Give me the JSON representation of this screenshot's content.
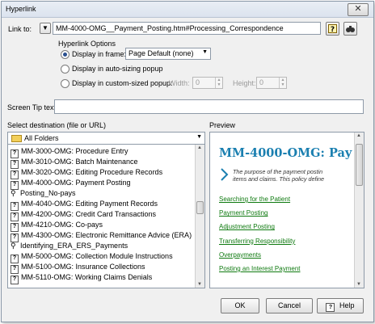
{
  "window": {
    "title": "Hyperlink",
    "close_glyph": "✕"
  },
  "link": {
    "label": "Link to:",
    "value": "MM-4000-OMG__Payment_Posting.htm#Processing_Correspondence"
  },
  "options": {
    "group_label": "Hyperlink Options",
    "frame_label": "Display in frame:",
    "frame_value": "Page Default (none)",
    "autosize_label": "Display in auto-sizing popup",
    "custom_label": "Display in custom-sized popup:",
    "width_label": "Width:",
    "width_value": "0",
    "height_label": "Height:",
    "height_value": "0"
  },
  "screentip": {
    "label": "Screen Tip text:",
    "value": ""
  },
  "destination": {
    "label": "Select destination (file or URL)",
    "folder": "All Folders",
    "items": [
      {
        "icon": "topic",
        "label": "MM-3000-OMG: Procedure Entry"
      },
      {
        "icon": "topic",
        "label": "MM-3010-OMG: Batch Maintenance"
      },
      {
        "icon": "topic",
        "label": "MM-3020-OMG: Editing Procedure Records"
      },
      {
        "icon": "topic",
        "label": "MM-4000-OMG: Payment Posting"
      },
      {
        "icon": "bookmark",
        "label": "Posting_No-pays"
      },
      {
        "icon": "topic",
        "label": "MM-4040-OMG: Editing Payment Records"
      },
      {
        "icon": "topic",
        "label": "MM-4200-OMG: Credit Card Transactions"
      },
      {
        "icon": "topic",
        "label": "MM-4210-OMG: Co-pays"
      },
      {
        "icon": "topic",
        "label": "MM-4300-OMG: Electronic Remittance Advice (ERA)"
      },
      {
        "icon": "bookmark",
        "label": "Identifying_ERA_ERS_Payments"
      },
      {
        "icon": "topic",
        "label": "MM-5000-OMG: Collection Module Instructions"
      },
      {
        "icon": "topic",
        "label": "MM-5100-OMG: Insurance Collections"
      },
      {
        "icon": "topic",
        "label": "MM-5110-OMG: Working Claims Denials"
      }
    ]
  },
  "preview": {
    "label": "Preview",
    "heading": "MM-4000-OMG: Pay",
    "intro_line1": "The purpose of the payment postin",
    "intro_line2": "items and claims. This policy define",
    "links": [
      "Searching for the Patient",
      "Payment Posting",
      "Adjustment Posting",
      "Transferring Responsibility",
      "Overpayments",
      "Posting an Interest Payment"
    ],
    "heading_color": "#1a7fb0",
    "link_color": "#0f7a10"
  },
  "buttons": {
    "ok": "OK",
    "cancel": "Cancel",
    "help": "Help"
  }
}
